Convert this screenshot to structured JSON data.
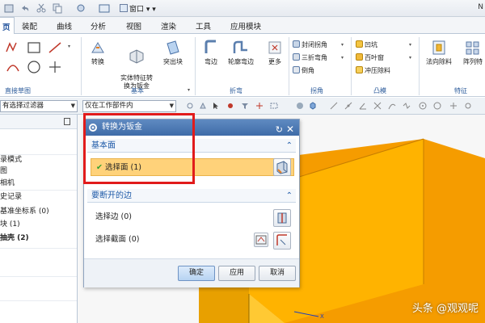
{
  "title_bar": {
    "window_menu_label": "窗口",
    "title_fragment": "N"
  },
  "menu_tabs": [
    {
      "label": "页"
    },
    {
      "label": "装配"
    },
    {
      "label": "曲线"
    },
    {
      "label": "分析"
    },
    {
      "label": "视图"
    },
    {
      "label": "渲染"
    },
    {
      "label": "工具"
    },
    {
      "label": "应用模块"
    }
  ],
  "ribbon": {
    "groups": {
      "sketch": "直接草图",
      "basic": "基本",
      "bend": "折弯",
      "corner": "拐角",
      "form": "凸模",
      "feature": "特征"
    },
    "buttons": {
      "convert": "转换",
      "solid_to_sheet": "实体特征转\n换为钣金",
      "tab": "突出块",
      "bend": "弯边",
      "contour_flange": "轮廓弯边",
      "more": "更多",
      "closed_corner": "封闭拐角",
      "three_bend_corner": "三折弯角",
      "chamfer": "倒角",
      "dimple": "凹坑",
      "louver": "百叶窗",
      "drawn_cutout": "冲压除料",
      "normal_cutout": "法向除料",
      "array_feature": "阵列特"
    }
  },
  "filter_bar": {
    "selection_filter": "有选择过滤器",
    "scope": "仅在工作部件内"
  },
  "navigator": {
    "items": [
      {
        "label": "录模式",
        "bold": false
      },
      {
        "label": "图",
        "bold": false
      },
      {
        "label": "相机",
        "bold": false
      },
      {
        "label": "史记录",
        "bold": false
      },
      {
        "label": "基准坐标系 (0)",
        "bold": false
      },
      {
        "label": "块 (1)",
        "bold": false
      },
      {
        "label": "抽壳 (2)",
        "bold": true
      }
    ]
  },
  "dialog": {
    "title": "转换为钣金",
    "section_base": "基本面",
    "select_face": "选择面 (1)",
    "section_edges": "要断开的边",
    "select_edge": "选择边 (0)",
    "select_section": "选择截面 (0)",
    "ok": "确定",
    "apply": "应用",
    "cancel": "取消"
  },
  "watermark": "头条 @观观呢",
  "colors": {
    "annotation_red": "#e11b1b",
    "part_face_front": "#ffb300",
    "part_face_side": "#f59c00",
    "dialog_title_bg": "#4a78b3",
    "selection_highlight": "#ffd27a"
  }
}
